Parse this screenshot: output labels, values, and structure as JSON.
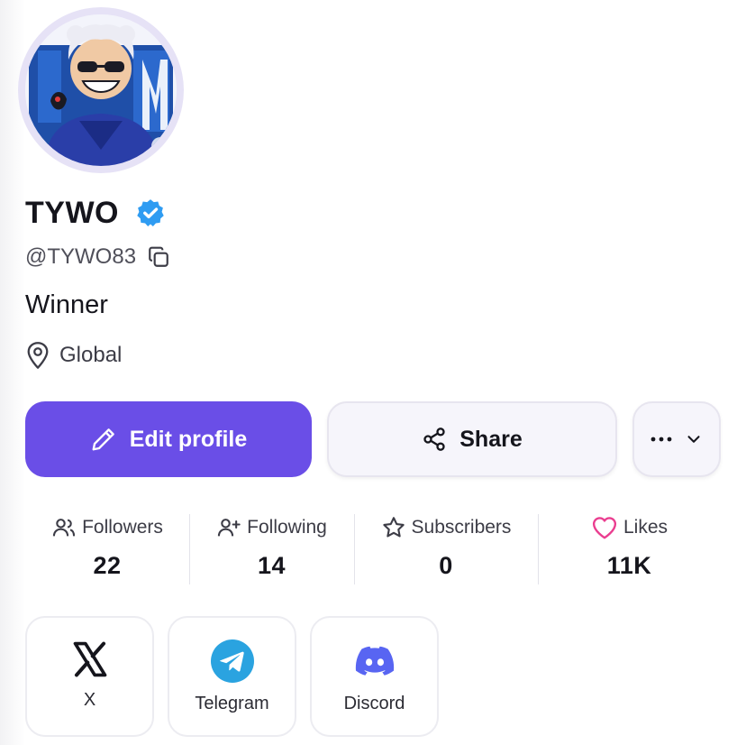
{
  "profile": {
    "display_name": "TYWO",
    "handle": "@TYWO83",
    "bio": "Winner",
    "location": "Global"
  },
  "actions": {
    "edit_label": "Edit profile",
    "share_label": "Share"
  },
  "stats": [
    {
      "label": "Followers",
      "value": "22",
      "icon": "people-icon"
    },
    {
      "label": "Following",
      "value": "14",
      "icon": "person-plus-icon"
    },
    {
      "label": "Subscribers",
      "value": "0",
      "icon": "star-icon"
    },
    {
      "label": "Likes",
      "value": "11K",
      "icon": "heart-icon"
    }
  ],
  "socials": [
    {
      "label": "X",
      "icon": "x-logo-icon"
    },
    {
      "label": "Telegram",
      "icon": "telegram-icon"
    },
    {
      "label": "Discord",
      "icon": "discord-icon"
    }
  ],
  "colors": {
    "accent": "#6a4ee7",
    "verified": "#2f9cf2",
    "likes": "#ea3d8f",
    "telegram": "#2aa3e0",
    "discord": "#5865f2"
  }
}
